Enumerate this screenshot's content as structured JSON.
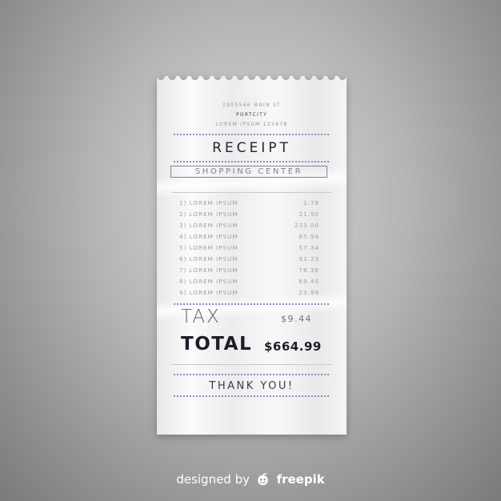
{
  "receipt": {
    "address_line1": "1905546 MAIN ST",
    "city": "PORTCITY",
    "address_line3": "LOREM IPSUM 125678",
    "title": "RECEIPT",
    "subtitle": "SHOPPING CENTER",
    "items": [
      {
        "label": "1) LOREM IPSUM",
        "price": "1.78"
      },
      {
        "label": "2) LOREM IPSUM",
        "price": "21.90"
      },
      {
        "label": "3) LOREM IPSUM",
        "price": "233.00"
      },
      {
        "label": "4) LOREM IPSUM",
        "price": "85.94"
      },
      {
        "label": "5) LOREM IPSUM",
        "price": "57.34"
      },
      {
        "label": "6) LOREM IPSUM",
        "price": "93.23"
      },
      {
        "label": "7) LOREM IPSUM",
        "price": "78.36"
      },
      {
        "label": "8) LOREM IPSUM",
        "price": "69.45"
      },
      {
        "label": "9) LOREM IPSUM",
        "price": "23.99"
      }
    ],
    "tax_label": "TAX",
    "tax_value": "$9.44",
    "total_label": "TOTAL",
    "total_value": "$664.99",
    "thank_you": "THANK YOU!"
  },
  "credit": {
    "prefix": "designed by",
    "brand": "freepik"
  },
  "colors": {
    "ink": "#1f2436",
    "accent_dots": "#6b7cb0",
    "paper": "#f4f4f4"
  }
}
